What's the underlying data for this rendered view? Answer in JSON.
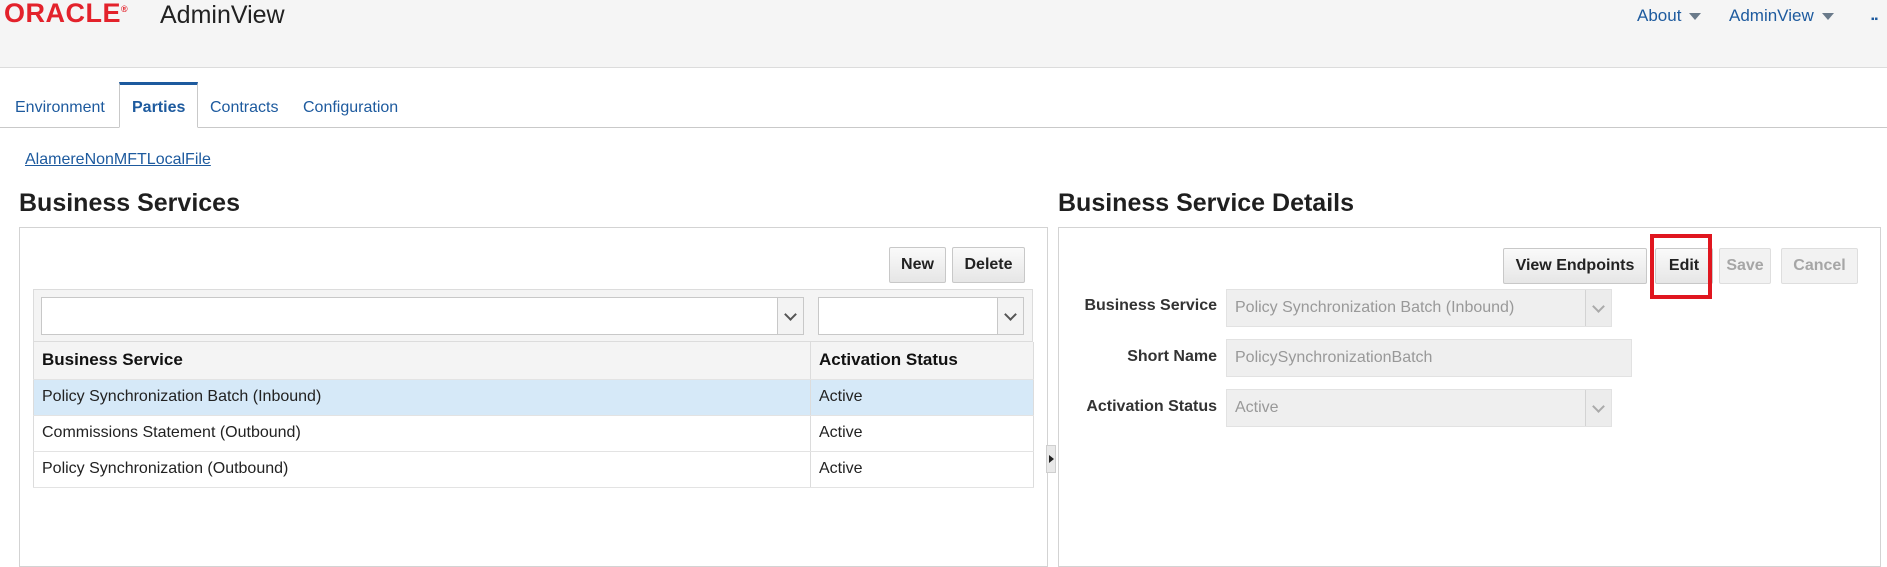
{
  "header": {
    "logo": "ORACLE",
    "app_title": "AdminView",
    "menus": [
      {
        "label": "About"
      },
      {
        "label": "AdminView"
      }
    ]
  },
  "tabs": [
    {
      "label": "Environment",
      "active": false
    },
    {
      "label": "Parties",
      "active": true
    },
    {
      "label": "Contracts",
      "active": false
    },
    {
      "label": "Configuration",
      "active": false
    }
  ],
  "breadcrumb": "AlamereNonMFTLocalFile",
  "left_panel": {
    "title": "Business Services",
    "buttons": {
      "new": "New",
      "delete": "Delete"
    },
    "columns": [
      "Business Service",
      "Activation Status"
    ],
    "rows": [
      {
        "service": "Policy Synchronization Batch (Inbound)",
        "status": "Active",
        "selected": true
      },
      {
        "service": "Commissions Statement (Outbound)",
        "status": "Active",
        "selected": false
      },
      {
        "service": "Policy Synchronization (Outbound)",
        "status": "Active",
        "selected": false
      }
    ]
  },
  "right_panel": {
    "title": "Business Service Details",
    "buttons": {
      "view_endpoints": "View Endpoints",
      "edit": "Edit",
      "save": "Save",
      "cancel": "Cancel"
    },
    "fields": {
      "business_service": {
        "label": "Business Service",
        "value": "Policy Synchronization Batch (Inbound)"
      },
      "short_name": {
        "label": "Short Name",
        "value": "PolicySynchronizationBatch"
      },
      "activation_status": {
        "label": "Activation Status",
        "value": "Active"
      }
    }
  },
  "colors": {
    "brand_red": "#e3222b",
    "link_blue": "#1d5a9e",
    "selected_row": "#d6e9f8",
    "highlight": "#e0161f"
  }
}
